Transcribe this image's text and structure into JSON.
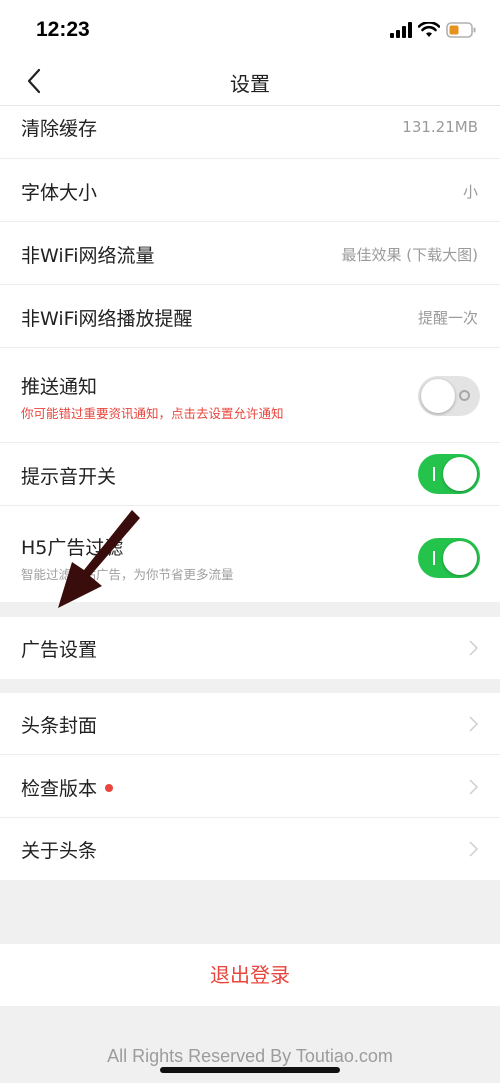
{
  "status_bar": {
    "time": "12:23"
  },
  "nav": {
    "title": "设置"
  },
  "settings_group1": [
    {
      "title": "清除缓存",
      "value": "131.21MB"
    },
    {
      "title": "字体大小",
      "value": "小"
    },
    {
      "title": "非WiFi网络流量",
      "value": "最佳效果 (下载大图)"
    },
    {
      "title": "非WiFi网络播放提醒",
      "value": "提醒一次"
    }
  ],
  "push": {
    "title": "推送通知",
    "subtitle": "你可能错过重要资讯通知，点击去设置允许通知",
    "enabled": false
  },
  "sound": {
    "title": "提示音开关",
    "enabled": true
  },
  "h5_filter": {
    "title": "H5广告过滤",
    "subtitle": "智能过滤网站广告，为你节省更多流量",
    "enabled": true
  },
  "ad_settings": {
    "title": "广告设置"
  },
  "settings_group3": [
    {
      "title": "头条封面"
    },
    {
      "title": "检查版本",
      "badge": true
    },
    {
      "title": "关于头条"
    }
  ],
  "logout": {
    "label": "退出登录"
  },
  "footer": {
    "text": "All Rights Reserved By Toutiao.com"
  },
  "colors": {
    "accent_red": "#e8453c",
    "toggle_on": "#24c44c"
  }
}
